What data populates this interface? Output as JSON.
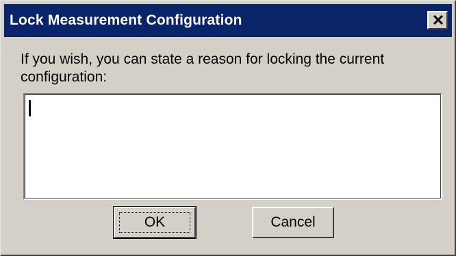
{
  "window": {
    "title": "Lock Measurement Configuration",
    "close_icon": "close-icon"
  },
  "prompt": {
    "text": "If you wish, you can state a reason for locking the current configuration:"
  },
  "reason_input": {
    "value": ""
  },
  "buttons": {
    "ok_label": "OK",
    "cancel_label": "Cancel"
  },
  "colors": {
    "titlebar": "#0a246a",
    "face": "#d4d0c8"
  }
}
